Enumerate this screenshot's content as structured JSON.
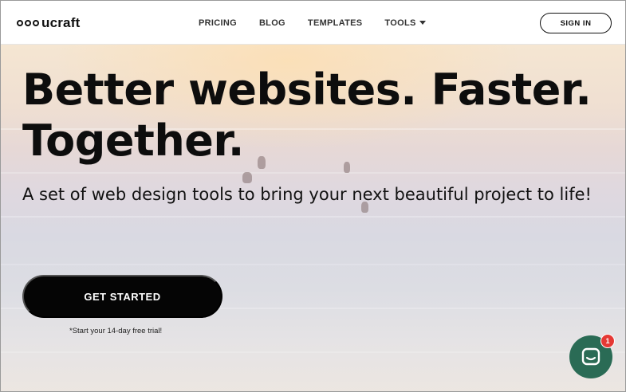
{
  "brand": {
    "name": "ucraft"
  },
  "nav": {
    "items": [
      {
        "label": "PRICING"
      },
      {
        "label": "BLOG"
      },
      {
        "label": "TEMPLATES"
      },
      {
        "label": "TOOLS"
      }
    ],
    "signin_label": "SIGN IN"
  },
  "hero": {
    "headline_line1": "Better websites. Faster.",
    "headline_line2": "Together.",
    "subline": "A set of web design tools to bring your next beautiful project to life!",
    "cta_label": "GET STARTED",
    "trial_note": "*Start your 14-day free trial!"
  },
  "chat": {
    "badge_count": "1"
  },
  "colors": {
    "cta_bg": "#050505",
    "chat_bg": "#2a6b55",
    "badge_bg": "#e53935"
  },
  "icons": {
    "logo": "three-circles-logo-icon",
    "tools_caret": "caret-down-icon",
    "chat": "chat-bubble-icon"
  }
}
